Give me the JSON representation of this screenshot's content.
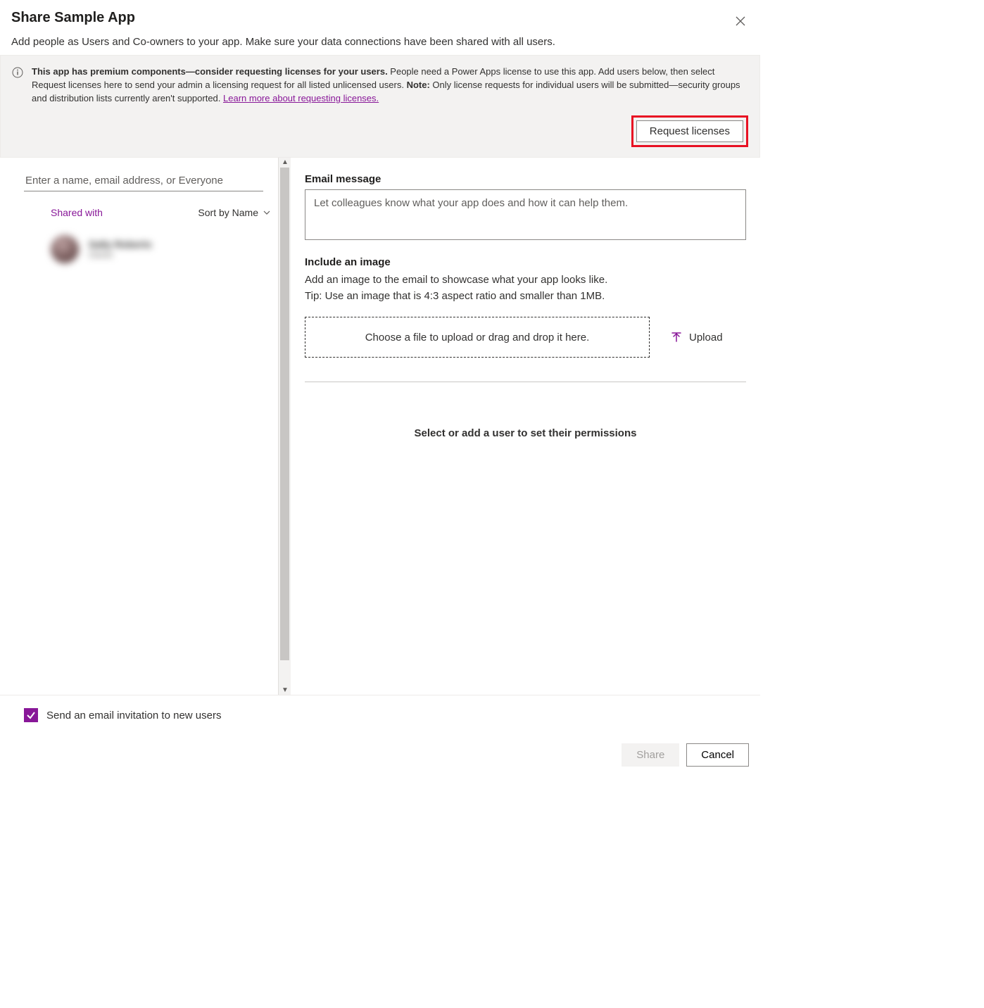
{
  "header": {
    "title": "Share Sample App",
    "subtitle": "Add people as Users and Co-owners to your app. Make sure your data connections have been shared with all users."
  },
  "notice": {
    "bold_lead": "This app has premium components—consider requesting licenses for your users.",
    "body1": " People need a Power Apps license to use this app. Add users below, then select Request licenses here to send your admin a licensing request for all listed unlicensed users. ",
    "note_label": "Note:",
    "body2": " Only license requests for individual users will be submitted—security groups and distribution lists currently aren't supported. ",
    "link": "Learn more about requesting licenses.",
    "request_button": "Request licenses"
  },
  "left": {
    "search_placeholder": "Enter a name, email address, or Everyone",
    "shared_with": "Shared with",
    "sort_label": "Sort by Name",
    "user": {
      "name": "Sally Roberts",
      "role": "Owner"
    }
  },
  "right": {
    "email_label": "Email message",
    "email_placeholder": "Let colleagues know what your app does and how it can help them.",
    "image_label": "Include an image",
    "image_help1": "Add an image to the email to showcase what your app looks like.",
    "image_help2": "Tip: Use an image that is 4:3 aspect ratio and smaller than 1MB.",
    "dropzone": "Choose a file to upload or drag and drop it here.",
    "upload_label": "Upload",
    "permissions_prompt": "Select or add a user to set their permissions"
  },
  "footer": {
    "checkbox_label": "Send an email invitation to new users",
    "share_button": "Share",
    "cancel_button": "Cancel"
  }
}
